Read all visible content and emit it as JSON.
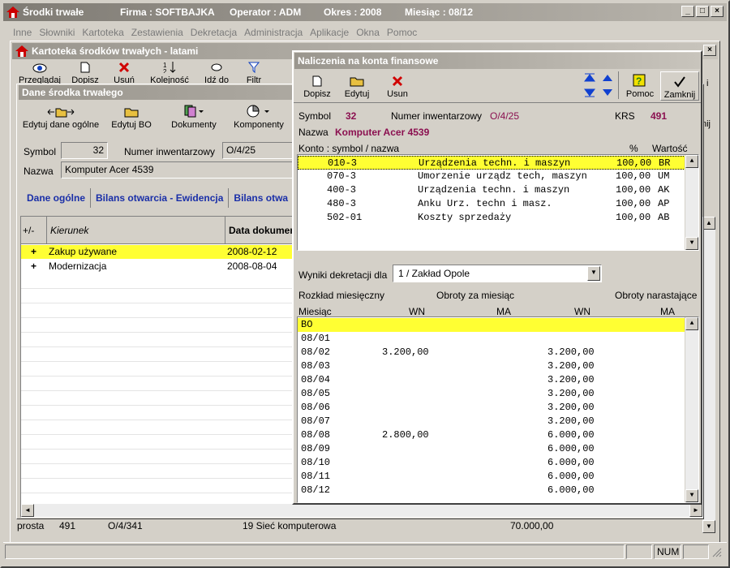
{
  "main_window": {
    "title": "Środki trwałe",
    "firma": "Firma : SOFTBAJKA",
    "operator": "Operator : ADM",
    "okres": "Okres : 2008",
    "miesiac": "Miesiąc : 08/12"
  },
  "menu": [
    "Inne",
    "Słowniki",
    "Kartoteka",
    "Zestawienia",
    "Dekretacja",
    "Administracja",
    "Aplikacje",
    "Okna",
    "Pomoc"
  ],
  "kartoteka": {
    "title": "Kartoteka środków trwałych - latami",
    "tools": [
      "Przeglądaj",
      "Dopisz",
      "Usuń",
      "Kolejność",
      "Idź do",
      "Filtr"
    ],
    "bottom_row": {
      "c1": "prosta",
      "c2": "491",
      "c3": "O/4/341",
      "c4": "19 Sieć komputerowa",
      "c5": "70.000,00"
    },
    "right_tool_fragment": "i",
    "right_tool_fragment2": "nij"
  },
  "dane": {
    "title": "Dane środka trwałego",
    "tools": [
      "Edytuj dane ogólne",
      "Edytuj BO",
      "Dokumenty",
      "Komponenty"
    ],
    "symbol_label": "Symbol",
    "symbol_value": "32",
    "nr_label": "Numer inwentarzowy",
    "nr_value": "O/4/25",
    "nazwa_label": "Nazwa",
    "nazwa_value": "Komputer Acer 4539",
    "tabs": [
      "Dane ogólne",
      "Bilans otwarcia - Ewidencja",
      "Bilans otwa"
    ],
    "grid_headers": [
      "+/-",
      "Kierunek",
      "Data dokumen"
    ],
    "grid_rows": [
      {
        "sign": "+",
        "kierunek": "Zakup używane",
        "data": "2008-02-12"
      },
      {
        "sign": "+",
        "kierunek": "Modernizacja",
        "data": "2008-08-04"
      }
    ]
  },
  "naliczenia": {
    "title": "Naliczenia na konta finansowe",
    "tools": [
      "Dopisz",
      "Edytuj",
      "Usun",
      "Pomoc",
      "Zamknij"
    ],
    "symbol_label": "Symbol",
    "symbol_value": "32",
    "nr_label": "Numer inwentarzowy",
    "nr_value": "O/4/25",
    "krs_label": "KRS",
    "krs_value": "491",
    "nazwa_label": "Nazwa",
    "nazwa_value": "Komputer Acer 4539",
    "konto_header": "Konto : symbol / nazwa",
    "pct_header": "%",
    "wartosc_header": "Wartość",
    "konta": [
      {
        "symbol": "010-3",
        "nazwa": "Urządzenia techn. i maszyn",
        "pct": "100,00",
        "w": "BR"
      },
      {
        "symbol": "070-3",
        "nazwa": "Umorzenie urządz tech, maszyn",
        "pct": "100,00",
        "w": "UM"
      },
      {
        "symbol": "400-3",
        "nazwa": "Urządzenia techn. i maszyn",
        "pct": "100,00",
        "w": "AK"
      },
      {
        "symbol": "480-3",
        "nazwa": "Anku Urz. techn i masz.",
        "pct": "100,00",
        "w": "AP"
      },
      {
        "symbol": "502-01",
        "nazwa": "Koszty sprzedaży",
        "pct": "100,00",
        "w": "AB"
      }
    ],
    "wyniki_label": "Wyniki dekretacji dla",
    "wyniki_value": "1  /  Zakład Opole",
    "rozklad_label": "Rozkład miesięczny",
    "obroty_label": "Obroty za miesiąc",
    "narastajace_label": "Obroty narastające",
    "col_miesiac": "Miesiąc",
    "col_wn1": "WN",
    "col_ma1": "MA",
    "col_wn2": "WN",
    "col_ma2": "MA",
    "miesiace": [
      {
        "m": "BO",
        "wn": "",
        "ma": "",
        "nwn": "",
        "nma": ""
      },
      {
        "m": "08/01",
        "wn": "",
        "ma": "",
        "nwn": "",
        "nma": ""
      },
      {
        "m": "08/02",
        "wn": "3.200,00",
        "ma": "",
        "nwn": "3.200,00",
        "nma": ""
      },
      {
        "m": "08/03",
        "wn": "",
        "ma": "",
        "nwn": "3.200,00",
        "nma": ""
      },
      {
        "m": "08/04",
        "wn": "",
        "ma": "",
        "nwn": "3.200,00",
        "nma": ""
      },
      {
        "m": "08/05",
        "wn": "",
        "ma": "",
        "nwn": "3.200,00",
        "nma": ""
      },
      {
        "m": "08/06",
        "wn": "",
        "ma": "",
        "nwn": "3.200,00",
        "nma": ""
      },
      {
        "m": "08/07",
        "wn": "",
        "ma": "",
        "nwn": "3.200,00",
        "nma": ""
      },
      {
        "m": "08/08",
        "wn": "2.800,00",
        "ma": "",
        "nwn": "6.000,00",
        "nma": ""
      },
      {
        "m": "08/09",
        "wn": "",
        "ma": "",
        "nwn": "6.000,00",
        "nma": ""
      },
      {
        "m": "08/10",
        "wn": "",
        "ma": "",
        "nwn": "6.000,00",
        "nma": ""
      },
      {
        "m": "08/11",
        "wn": "",
        "ma": "",
        "nwn": "6.000,00",
        "nma": ""
      },
      {
        "m": "08/12",
        "wn": "",
        "ma": "",
        "nwn": "6.000,00",
        "nma": ""
      }
    ]
  },
  "statusbar": {
    "num": "NUM"
  }
}
